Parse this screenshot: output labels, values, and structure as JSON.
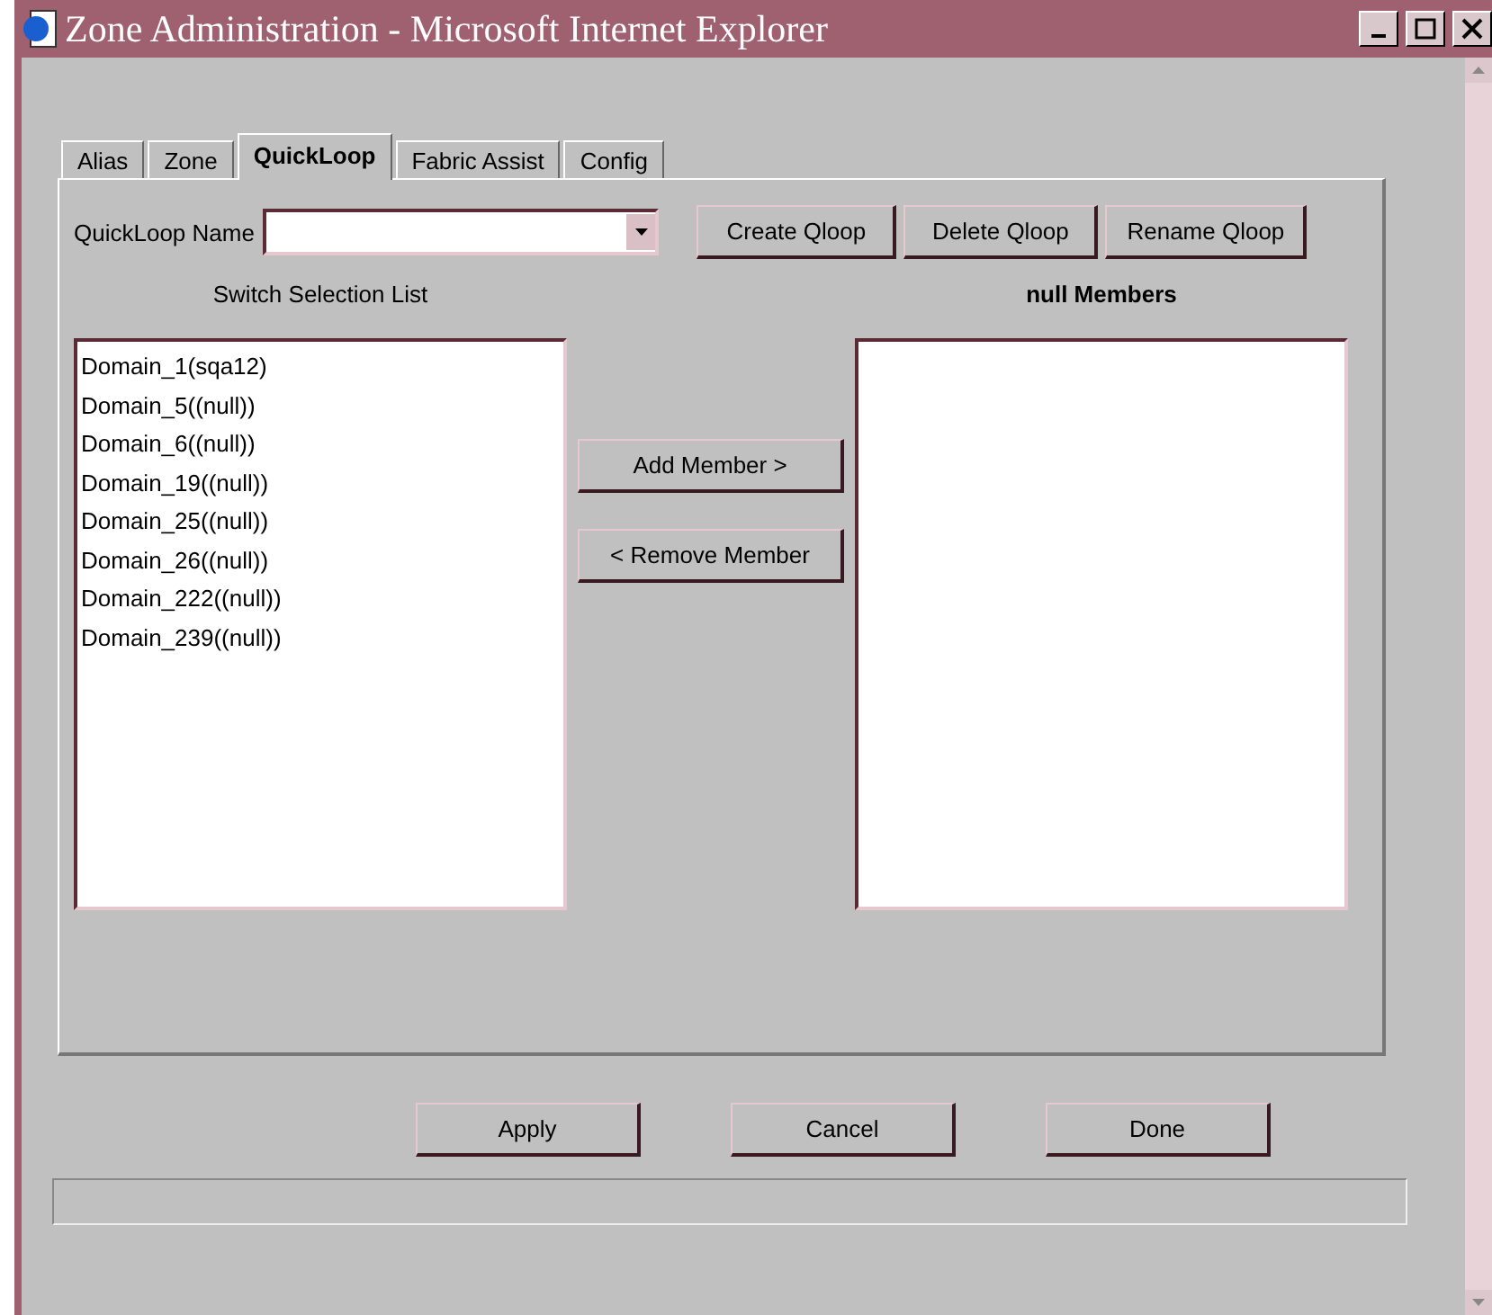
{
  "window": {
    "title": "Zone Administration - Microsoft Internet Explorer"
  },
  "tabs": [
    {
      "label": "Alias",
      "selected": false
    },
    {
      "label": "Zone",
      "selected": false
    },
    {
      "label": "QuickLoop",
      "selected": true
    },
    {
      "label": "Fabric Assist",
      "selected": false
    },
    {
      "label": "Config",
      "selected": false
    }
  ],
  "quickloop_name": {
    "label": "QuickLoop Name"
  },
  "top_buttons": [
    "Create Qloop",
    "Delete Qloop",
    "Rename Qloop"
  ],
  "switch_list": {
    "heading": "Switch Selection List",
    "items": [
      "Domain_1(sqa12)",
      "Domain_5((null))",
      "Domain_6((null))",
      "Domain_19((null))",
      "Domain_25((null))",
      "Domain_26((null))",
      "Domain_222((null))",
      "Domain_239((null))"
    ]
  },
  "move_buttons": [
    "Add Member >",
    "< Remove Member"
  ],
  "members_list": {
    "heading": "null Members"
  },
  "bottom_buttons": [
    "Apply",
    "Cancel",
    "Done"
  ]
}
